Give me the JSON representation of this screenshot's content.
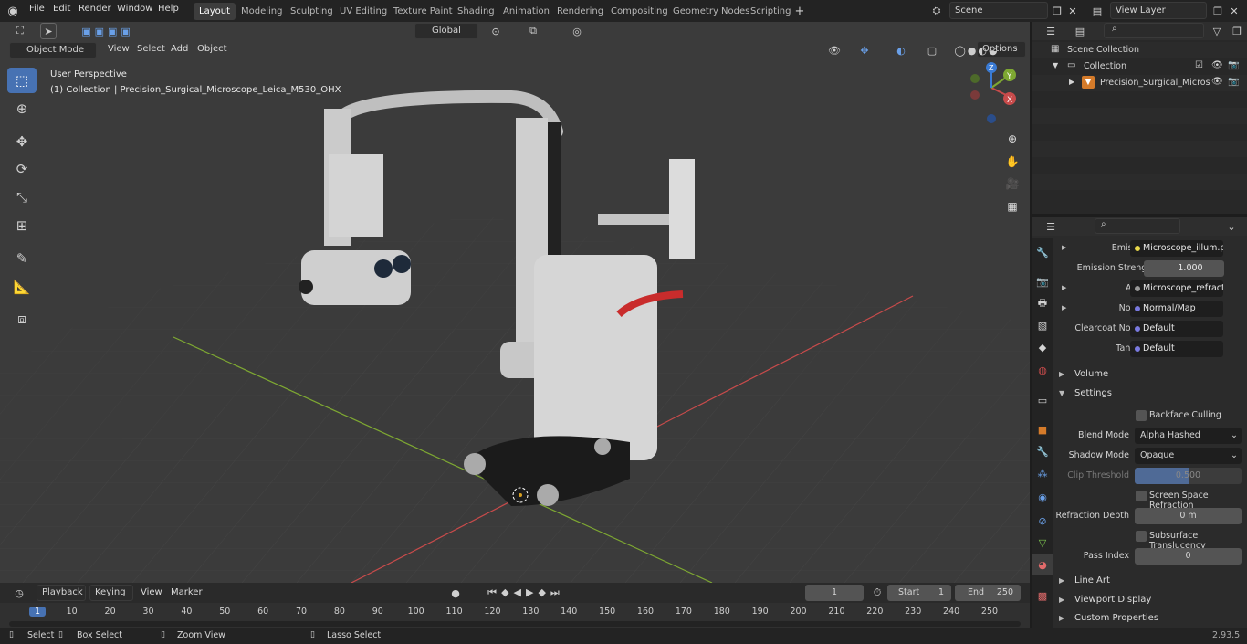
{
  "topbar": {
    "menus": [
      "File",
      "Edit",
      "Render",
      "Window",
      "Help"
    ],
    "workspaces": [
      "Layout",
      "Modeling",
      "Sculpting",
      "UV Editing",
      "Texture Paint",
      "Shading",
      "Animation",
      "Rendering",
      "Compositing",
      "Geometry Nodes",
      "Scripting"
    ],
    "active_workspace": "Layout",
    "scene": "Scene",
    "view_layer": "View Layer"
  },
  "viewport_header": {
    "mode": "Object Mode",
    "menus": [
      "View",
      "Select",
      "Add",
      "Object"
    ],
    "transform_orientation": "Global",
    "options": "Options"
  },
  "viewport": {
    "perspective": "User Perspective",
    "collection_info": "(1) Collection | Precision_Surgical_Microscope_Leica_M530_OHX",
    "gizmo_axes": [
      "X",
      "Y",
      "Z"
    ]
  },
  "outliner": {
    "scene_collection": "Scene Collection",
    "collection": "Collection",
    "object": "Precision_Surgical_Micros"
  },
  "properties": {
    "rows": [
      {
        "label": "Emission",
        "value": "Microscope_illum.png",
        "dot": "#e8d84a",
        "expand": true
      },
      {
        "label": "Emission Strengt",
        "value": "1.000",
        "dot": "#9a9a9a",
        "expand": false,
        "numeric": true
      },
      {
        "label": "Alpha",
        "value": "Microscope_refract_i...",
        "dot": "#9a9a9a",
        "expand": true
      },
      {
        "label": "Normal",
        "value": "Normal/Map",
        "dot": "#7a7ae0",
        "expand": true
      },
      {
        "label": "Clearcoat Normal",
        "value": "Default",
        "dot": "#7a7ae0",
        "expand": false
      },
      {
        "label": "Tangent",
        "value": "Default",
        "dot": "#7a7ae0",
        "expand": false
      }
    ],
    "volume": "Volume",
    "settings": "Settings",
    "backface_culling": "Backface Culling",
    "blend_mode_label": "Blend Mode",
    "blend_mode": "Alpha Hashed",
    "shadow_mode_label": "Shadow Mode",
    "shadow_mode": "Opaque",
    "clip_threshold_label": "Clip Threshold",
    "clip_threshold": "0.500",
    "ssr": "Screen Space Refraction",
    "refraction_depth_label": "Refraction Depth",
    "refraction_depth": "0 m",
    "sss": "Subsurface Translucency",
    "pass_index_label": "Pass Index",
    "pass_index": "0",
    "line_art": "Line Art",
    "viewport_display": "Viewport Display",
    "custom_properties": "Custom Properties"
  },
  "timeline": {
    "menus": [
      "Playback",
      "Keying",
      "View",
      "Marker"
    ],
    "current_frame": "1",
    "start_label": "Start",
    "start": "1",
    "end_label": "End",
    "end": "250",
    "ticks": [
      "1",
      "10",
      "20",
      "30",
      "40",
      "50",
      "60",
      "70",
      "80",
      "90",
      "100",
      "110",
      "120",
      "130",
      "140",
      "150",
      "160",
      "170",
      "180",
      "190",
      "200",
      "210",
      "220",
      "230",
      "240",
      "250"
    ]
  },
  "statusbar": {
    "select": "Select",
    "box_select": "Box Select",
    "zoom_view": "Zoom View",
    "lasso_select": "Lasso Select",
    "version": "2.93.5"
  },
  "colors": {
    "accent": "#4772b3",
    "x_axis": "#c84b4b",
    "y_axis": "#7ea832",
    "z_axis": "#3a7bd5"
  }
}
